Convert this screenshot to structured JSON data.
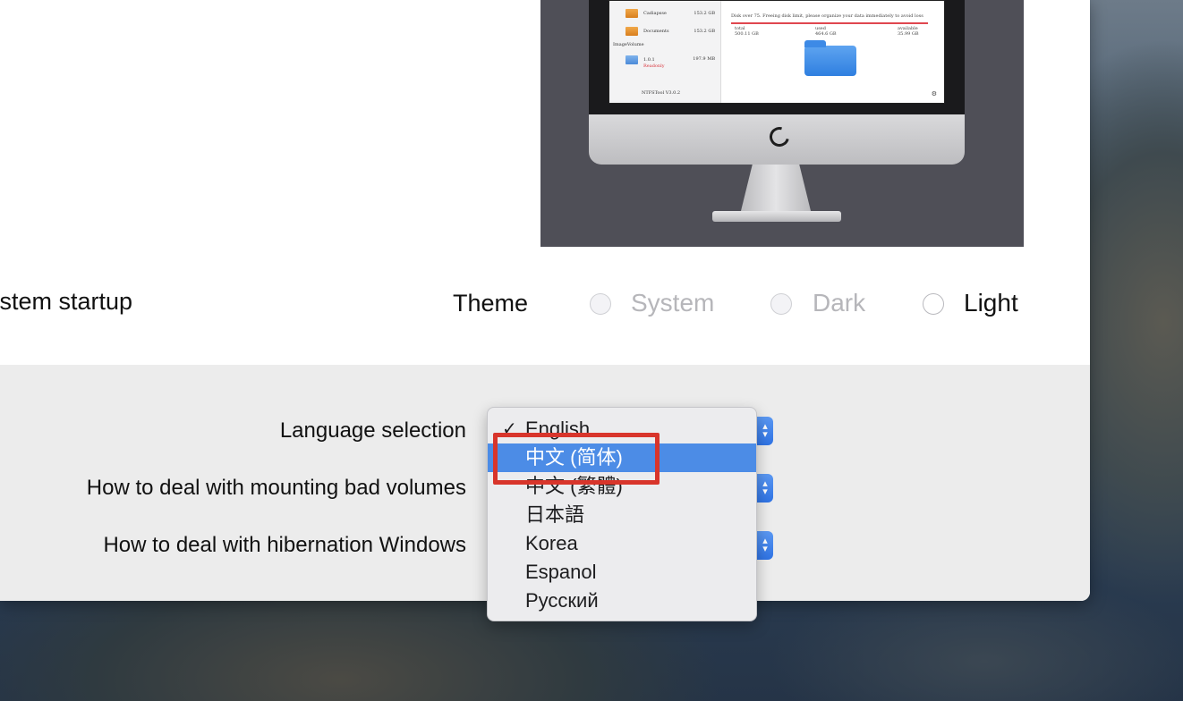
{
  "window": {
    "startup_label": "ystem startup",
    "theme": {
      "label": "Theme",
      "options": [
        {
          "label": "System",
          "enabled": false
        },
        {
          "label": "Dark",
          "enabled": false
        },
        {
          "label": "Light",
          "enabled": true
        }
      ]
    },
    "preview": {
      "sidebar_items": [
        {
          "name": "Cadiapsse",
          "size": "153.2 GB"
        },
        {
          "name": "Documents",
          "size": "153.2 GB"
        }
      ],
      "section_label": "ImageVolume",
      "volume": {
        "name": "1.0.1",
        "size": "197.9 MB",
        "status": "Readonly"
      },
      "version": "NTFSTool V3.0.2",
      "warning": "Disk over 75. Freeing disk limit, please organize your data immediately to avoid loss",
      "stats": [
        {
          "label": "total",
          "value": "500.11 GB"
        },
        {
          "label": "used",
          "value": "464.6 GB"
        },
        {
          "label": "available",
          "value": "35.99 GB"
        }
      ]
    },
    "settings": {
      "language_label": "Language selection",
      "bad_volumes_label": "How to deal with mounting bad volumes",
      "hibernation_label": "How to deal with hibernation Windows"
    },
    "language_menu": {
      "items": [
        {
          "label": "English",
          "checked": true,
          "selected": false
        },
        {
          "label": "中文 (简体)",
          "checked": false,
          "selected": true
        },
        {
          "label": "中文 (繁體)",
          "checked": false,
          "selected": false
        },
        {
          "label": "日本語",
          "checked": false,
          "selected": false
        },
        {
          "label": "Korea",
          "checked": false,
          "selected": false
        },
        {
          "label": "Espanol",
          "checked": false,
          "selected": false
        },
        {
          "label": "Русский",
          "checked": false,
          "selected": false
        }
      ]
    }
  },
  "colors": {
    "accent": "#4c8ce6",
    "highlight_box": "#d8352b",
    "panel": "#ececec"
  }
}
